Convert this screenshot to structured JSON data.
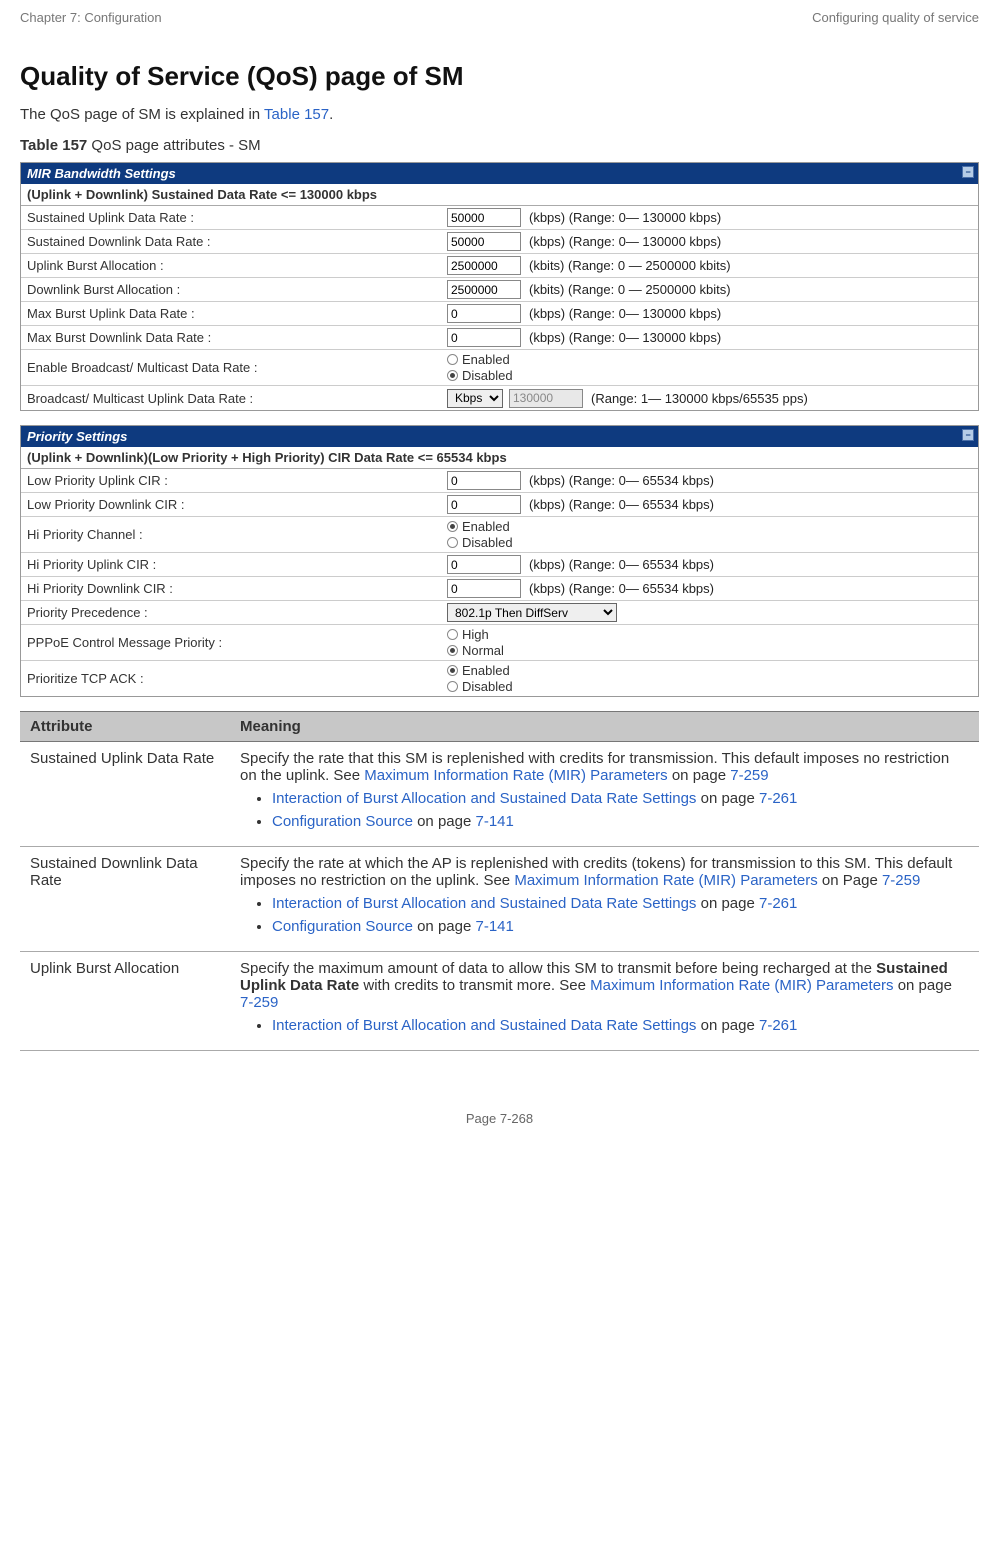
{
  "header": {
    "left": "Chapter 7:  Configuration",
    "right": "Configuring quality of service"
  },
  "title": "Quality of Service (QoS) page of SM",
  "intro_pre": "The QoS page of SM is explained in ",
  "intro_link": "Table 157",
  "intro_post": ".",
  "caption_bold": "Table 157",
  "caption_rest": " QoS page attributes - SM",
  "panel1": {
    "title": "MIR Bandwidth Settings",
    "sub_pre": "(Uplink + Downlink)  Sustained Data Rate <= 130000 ",
    "sub_bold": "kbps",
    "rows": {
      "r1": {
        "label": "Sustained Uplink Data Rate :",
        "value": "50000",
        "range": "(kbps) (Range: 0— 130000 kbps)"
      },
      "r2": {
        "label": "Sustained Downlink Data Rate :",
        "value": "50000",
        "range": "(kbps) (Range: 0— 130000 kbps)"
      },
      "r3": {
        "label": "Uplink Burst Allocation :",
        "value": "2500000",
        "range": "(kbits) (Range: 0 — 2500000 kbits)"
      },
      "r4": {
        "label": "Downlink Burst Allocation :",
        "value": "2500000",
        "range": "(kbits) (Range: 0 — 2500000 kbits)"
      },
      "r5": {
        "label": "Max Burst Uplink Data Rate :",
        "value": "0",
        "range": "(kbps) (Range: 0— 130000 kbps)"
      },
      "r6": {
        "label": "Max Burst Downlink Data Rate :",
        "value": "0",
        "range": "(kbps) (Range: 0— 130000 kbps)"
      },
      "r7": {
        "label": "Enable Broadcast/ Multicast Data Rate :",
        "opt1": "Enabled",
        "opt2": "Disabled"
      },
      "r8": {
        "label": "Broadcast/ Multicast Uplink Data Rate :",
        "select": "Kbps",
        "value": "130000",
        "range": "(Range: 1— 130000 kbps/65535 pps)"
      }
    }
  },
  "panel2": {
    "title": "Priority Settings",
    "sub_pre": "(Uplink + Downlink)(Low Priority + High Priority) CIR Data Rate <= 65534 ",
    "sub_bold": "kbps",
    "rows": {
      "r1": {
        "label": "Low Priority Uplink CIR :",
        "value": "0",
        "range": "(kbps) (Range: 0— 65534 kbps)"
      },
      "r2": {
        "label": "Low Priority Downlink CIR :",
        "value": "0",
        "range": "(kbps) (Range: 0— 65534 kbps)"
      },
      "r3": {
        "label": "Hi Priority Channel :",
        "opt1": "Enabled",
        "opt2": "Disabled"
      },
      "r4": {
        "label": "Hi Priority Uplink CIR :",
        "value": "0",
        "range": "(kbps) (Range: 0— 65534 kbps)"
      },
      "r5": {
        "label": "Hi Priority Downlink CIR :",
        "value": "0",
        "range": "(kbps) (Range: 0— 65534 kbps)"
      },
      "r6": {
        "label": "Priority Precedence :",
        "select": "802.1p Then DiffServ"
      },
      "r7": {
        "label": "PPPoE Control Message Priority :",
        "opt1": "High",
        "opt2": "Normal"
      },
      "r8": {
        "label": "Prioritize TCP ACK :",
        "opt1": "Enabled",
        "opt2": "Disabled"
      }
    }
  },
  "table_headers": {
    "attr": "Attribute",
    "mean": "Meaning"
  },
  "t_rows": {
    "r1": {
      "attr": "Sustained Uplink Data Rate",
      "p1a": "Specify the rate that this SM is replenished with credits for transmission. This default imposes no restriction on the uplink. See ",
      "p1link": "Maximum Information Rate (MIR) Parameters",
      "p1b": " on page ",
      "p1pg": "7-259",
      "li1a": "Interaction of Burst Allocation and Sustained Data Rate Settings",
      "li1b": " on page ",
      "li1pg": "7-261",
      "li2a": "Configuration Source",
      "li2b": " on page ",
      "li2pg": "7-141"
    },
    "r2": {
      "attr": "Sustained Downlink Data Rate",
      "p1a": "Specify the rate at which the AP is replenished with credits (tokens) for transmission to this SM. This default imposes no restriction on the uplink. See ",
      "p1link": "Maximum Information Rate (MIR) Parameters",
      "p1b": " on Page ",
      "p1pg": "7-259",
      "li1a": "Interaction of Burst Allocation and Sustained Data Rate Settings",
      "li1b": " on page ",
      "li1pg": "7-261",
      "li2a": "Configuration Source",
      "li2b": " on page ",
      "li2pg": "7-141"
    },
    "r3": {
      "attr": "Uplink Burst Allocation",
      "p1a": "Specify the maximum amount of data to allow this SM to transmit before being recharged at the ",
      "p1bold": "Sustained Uplink Data Rate",
      "p1b": " with credits to transmit more. See ",
      "p1link": "Maximum Information Rate (MIR) Parameters",
      "p1c": " on page ",
      "p1pg": "7-259",
      "li1a": "Interaction of Burst Allocation and Sustained Data Rate Settings",
      "li1b": " on page ",
      "li1pg": "7-261"
    }
  },
  "page_num": "Page 7-268"
}
